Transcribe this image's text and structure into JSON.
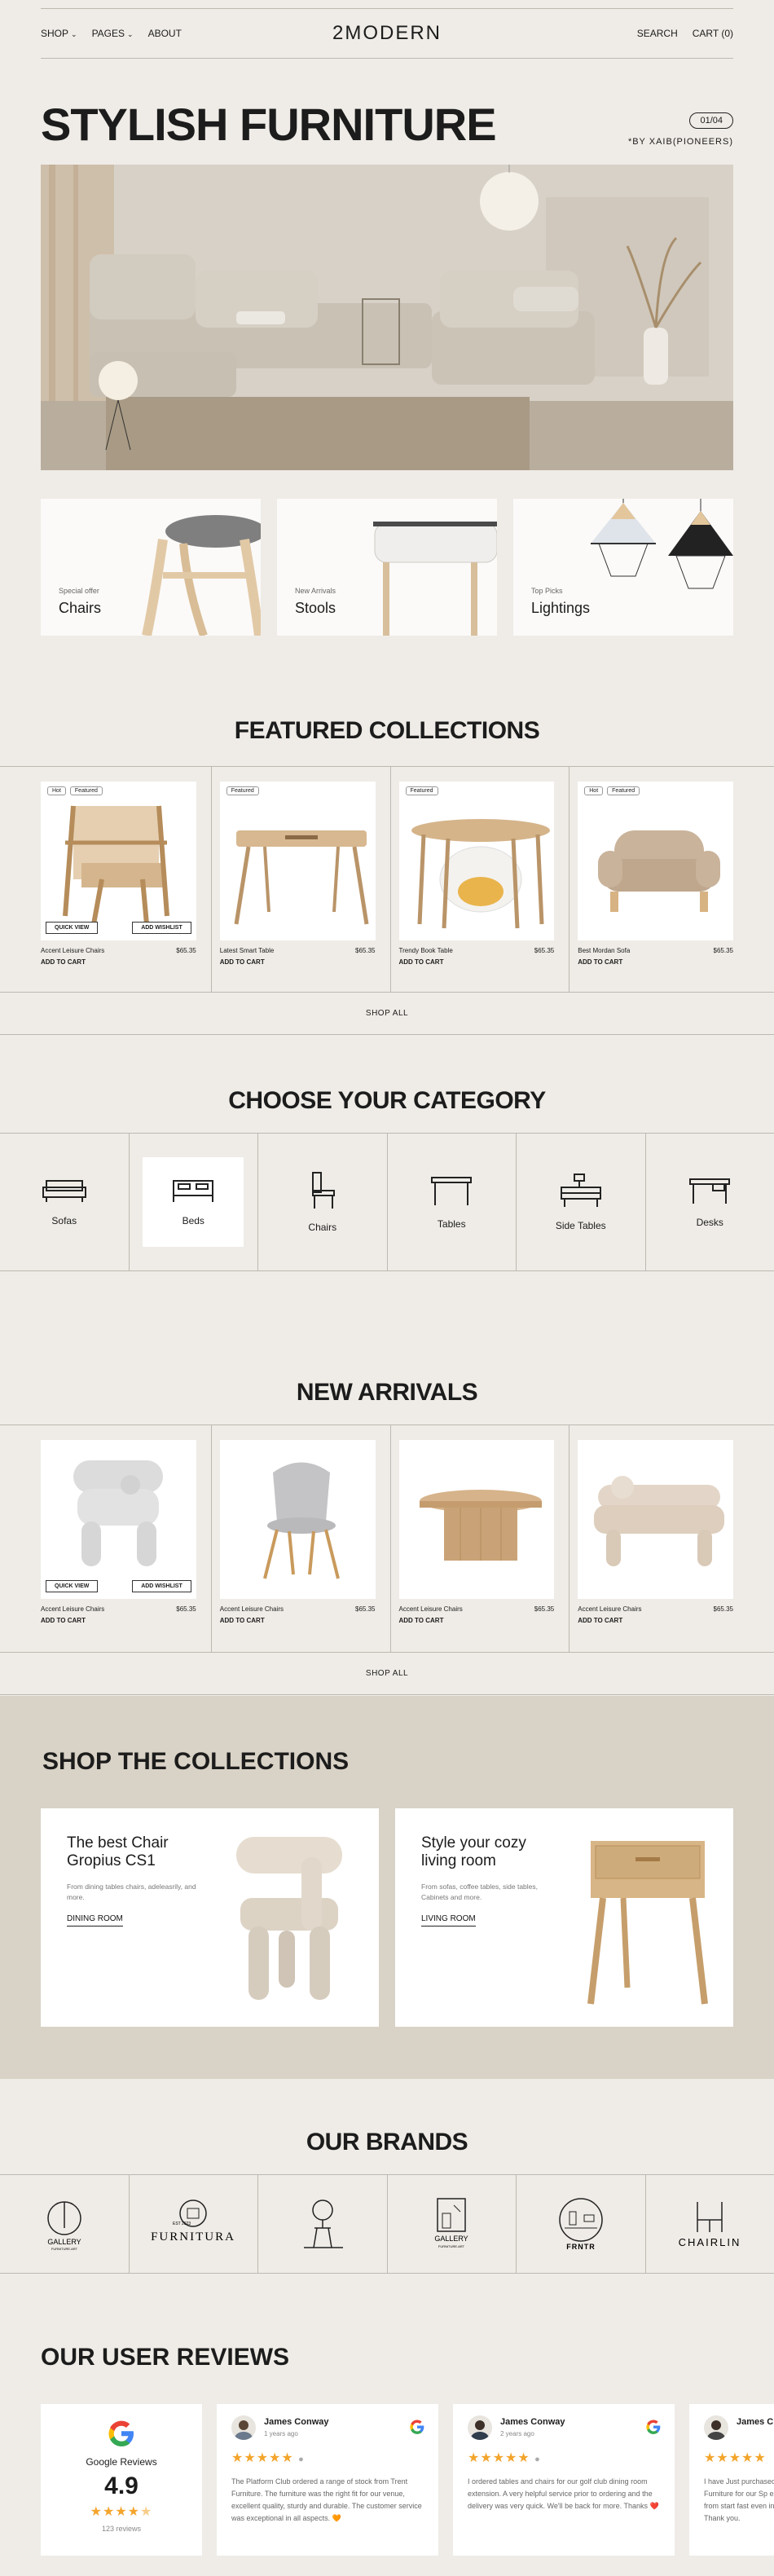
{
  "nav": {
    "shop": "SHOP",
    "pages": "PAGES",
    "about": "ABOUT",
    "logo": "2MODERN",
    "search": "SEARCH",
    "cart": "CART (0)"
  },
  "hero": {
    "title": "STYLISH FURNITURE",
    "pager": "01/04",
    "byline": "*BY XAIB(PIONEERS)"
  },
  "category_cards": [
    {
      "small": "Special offer",
      "label": "Chairs"
    },
    {
      "small": "New Arrivals",
      "label": "Stools"
    },
    {
      "small": "Top Picks",
      "label": "Lightings"
    }
  ],
  "featured": {
    "title": "FEATURED COLLECTIONS",
    "shop_all": "SHOP ALL",
    "quick_view": "QUICK VIEW",
    "add_wishlist": "ADD WISHLIST",
    "add_to_cart": "ADD TO CART",
    "products": [
      {
        "name": "Accent Leisure Chairs",
        "price": "$65.35",
        "badge1": "Hot",
        "badge2": "Featured"
      },
      {
        "name": "Latest Smart Table",
        "price": "$65.35",
        "badge1": "Featured"
      },
      {
        "name": "Trendy Book Table",
        "price": "$65.35",
        "badge1": "Featured"
      },
      {
        "name": "Best Mordan Sofa",
        "price": "$65.35",
        "badge1": "Hot",
        "badge2": "Featured"
      }
    ]
  },
  "categories": {
    "title": "CHOOSE YOUR CATEGORY",
    "items": [
      {
        "label": "Sofas",
        "icon": "sofa-icon"
      },
      {
        "label": "Beds",
        "icon": "bed-icon"
      },
      {
        "label": "Chairs",
        "icon": "chair-icon"
      },
      {
        "label": "Tables",
        "icon": "table-icon"
      },
      {
        "label": "Side Tables",
        "icon": "side-table-icon"
      },
      {
        "label": "Desks",
        "icon": "desk-icon"
      }
    ]
  },
  "arrivals": {
    "title": "NEW ARRIVALS",
    "shop_all": "SHOP ALL",
    "quick_view": "QUICK VIEW",
    "add_wishlist": "ADD WISHLIST",
    "add_to_cart": "ADD TO CART",
    "products": [
      {
        "name": "Accent Leisure Chairs",
        "price": "$65.35"
      },
      {
        "name": "Accent Leisure Chairs",
        "price": "$65.35"
      },
      {
        "name": "Accent Leisure Chairs",
        "price": "$65.35"
      },
      {
        "name": "Accent Leisure Chairs",
        "price": "$65.35"
      }
    ]
  },
  "collections": {
    "title": "SHOP THE COLLECTIONS",
    "cards": [
      {
        "heading": "The best Chair Gropius CS1",
        "desc": "From dining tables chairs, adeleasrily, and more.",
        "link": "DINING ROOM"
      },
      {
        "heading": "Style your cozy living room",
        "desc": "From sofas, coffee tables, side tables, Cabinets and more.",
        "link": "LIVING ROOM"
      }
    ]
  },
  "brands": {
    "title": "OUR BRANDS",
    "items": [
      {
        "name": "GALLERY",
        "sub": "FURNITURE.ART"
      },
      {
        "name": "FURNITURA",
        "sub": "EST 2023"
      },
      {
        "name": "",
        "sub": ""
      },
      {
        "name": "GALLERY",
        "sub": "FURNITURE.ART"
      },
      {
        "name": "FRNTR",
        "sub": ""
      },
      {
        "name": "CHAIRLIN",
        "sub": ""
      }
    ]
  },
  "reviews": {
    "title": "OUR USER REVIEWS",
    "google": {
      "label": "Google Reviews",
      "rating": "4.9",
      "count": "123 reviews",
      "stars": 4.5
    },
    "items": [
      {
        "name": "James Conway",
        "date": "1 years ago",
        "text": "The Platform Club ordered a range of stock from Trent Furniture. The furniture was the right fit for our venue, excellent quality, sturdy and durable. The customer service was exceptional in all aspects. 🧡"
      },
      {
        "name": "James Conway",
        "date": "2 years ago",
        "text": "I ordered tables and chairs for our golf club dining room extension. A very helpful service prior to ordering and the delivery was very quick. We'll be back for more. Thanks ❤️"
      },
      {
        "name": "James C",
        "date": "",
        "text": "I have Just purchased Furniture for our Sp excellent from start fast even in time for Thank you."
      }
    ]
  },
  "colors": {
    "bg": "#efece7",
    "band": "#d9d2c6",
    "star": "#f3a52c"
  }
}
